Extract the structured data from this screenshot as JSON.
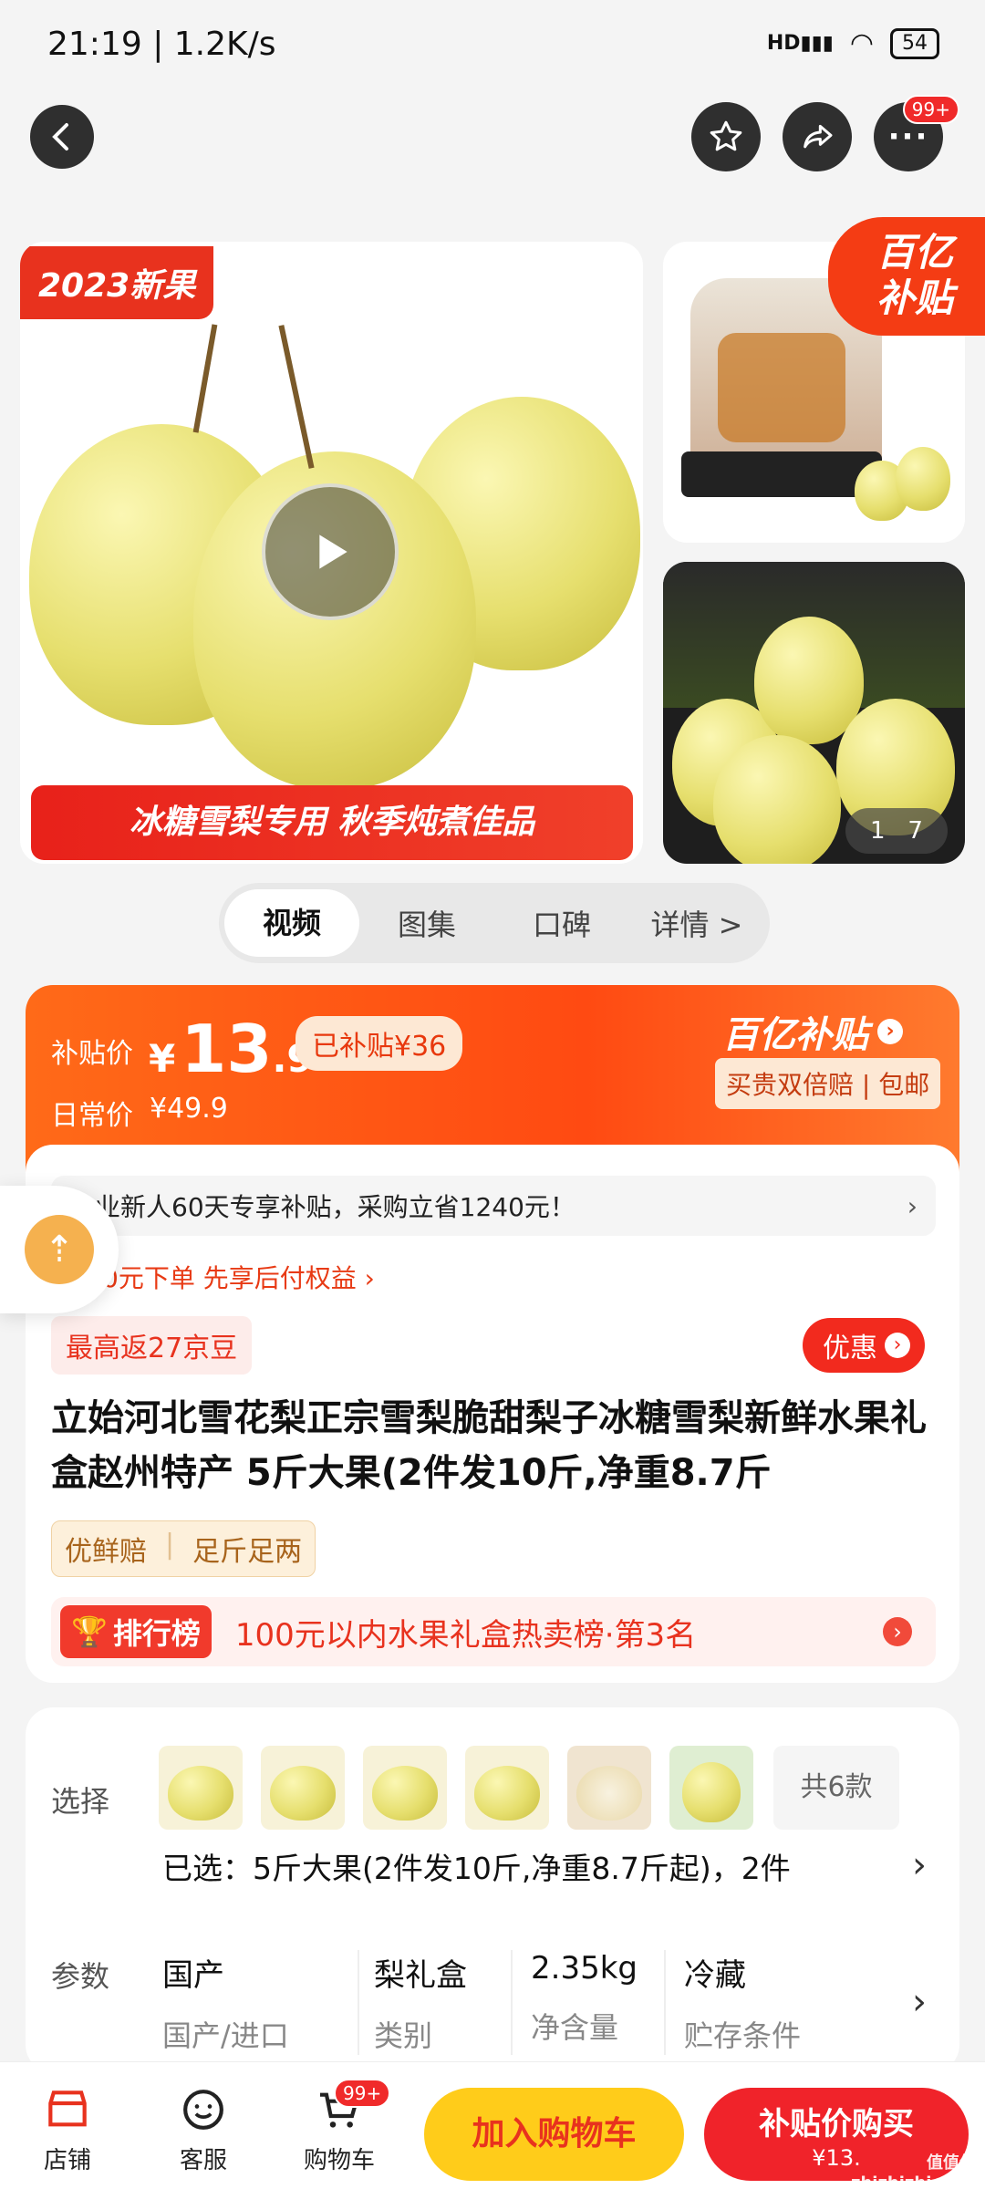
{
  "status": {
    "time": "21:19 | 1.2K/s",
    "battery": "54",
    "signal": "HD"
  },
  "nav": {
    "badge": "99+"
  },
  "gallery": {
    "badge_new": "2023新果",
    "banner": "冰糖雪梨专用  秋季炖煮佳品",
    "counter": "1   7",
    "subsidy_logo": "百亿补贴"
  },
  "tabs": [
    "视频",
    "图集",
    "口碑",
    "详情 >"
  ],
  "price": {
    "label": "补贴价",
    "currency": "¥",
    "int": "13",
    "dec": ".9",
    "subsidized": "已补贴¥36",
    "regular_label": "日常价",
    "regular": "¥49.9",
    "brand": "百亿补贴",
    "guarantee": "买贵双倍赔 | 包邮"
  },
  "info": {
    "enterprise": "企业新人60天专享补贴，采购立省1240元！",
    "zero_pay": "领取0元下单 先享后付权益 ›",
    "jingdou": "最高返27京豆",
    "coupon": "优惠",
    "title": "立始河北雪花梨正宗雪梨脆甜梨子冰糖雪梨新鲜水果礼盒赵州特产 5斤大果(2件发10斤,净重8.7斤",
    "tag1": "优鲜赔",
    "tag2": "足斤足两",
    "rank_label": "排行榜",
    "rank_text": "100元以内水果礼盒热卖榜·第3名"
  },
  "spec": {
    "select_label": "选择",
    "total": "共6款",
    "selected": "已选：5斤大果(2件发10斤,净重8.7斤起)，2件",
    "param_label": "参数",
    "params": [
      {
        "value": "国产",
        "name": "国产/进口"
      },
      {
        "value": "梨礼盒",
        "name": "类别"
      },
      {
        "value": "2.35kg",
        "name": "净含量"
      },
      {
        "value": "冷藏",
        "name": "贮存条件"
      }
    ]
  },
  "bottom": {
    "shop": "店铺",
    "service": "客服",
    "cart": "购物车",
    "cart_badge": "99+",
    "add_cart": "加入购物车",
    "buy": "补贴价购买",
    "buy_price": "¥13."
  },
  "watermark": "值值值 zhizhizhi.com"
}
